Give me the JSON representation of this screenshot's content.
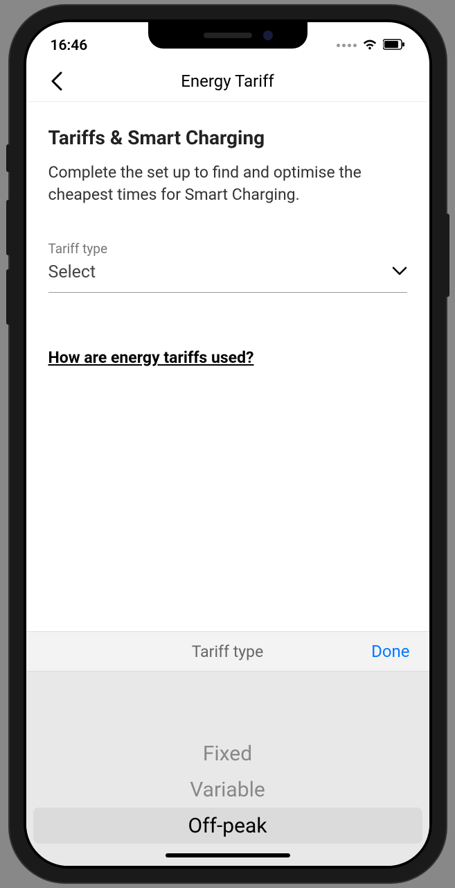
{
  "status": {
    "time": "16:46"
  },
  "nav": {
    "title": "Energy Tariff"
  },
  "section": {
    "title": "Tariffs & Smart Charging",
    "description": "Complete the set up to find and optimise the cheapest times for Smart Charging."
  },
  "tariff_field": {
    "label": "Tariff type",
    "value": "Select"
  },
  "help_link": "How are energy tariffs used?",
  "picker": {
    "title": "Tariff type",
    "done_label": "Done",
    "options": [
      "Fixed",
      "Variable",
      "Off-peak"
    ],
    "selected_index": 2
  }
}
